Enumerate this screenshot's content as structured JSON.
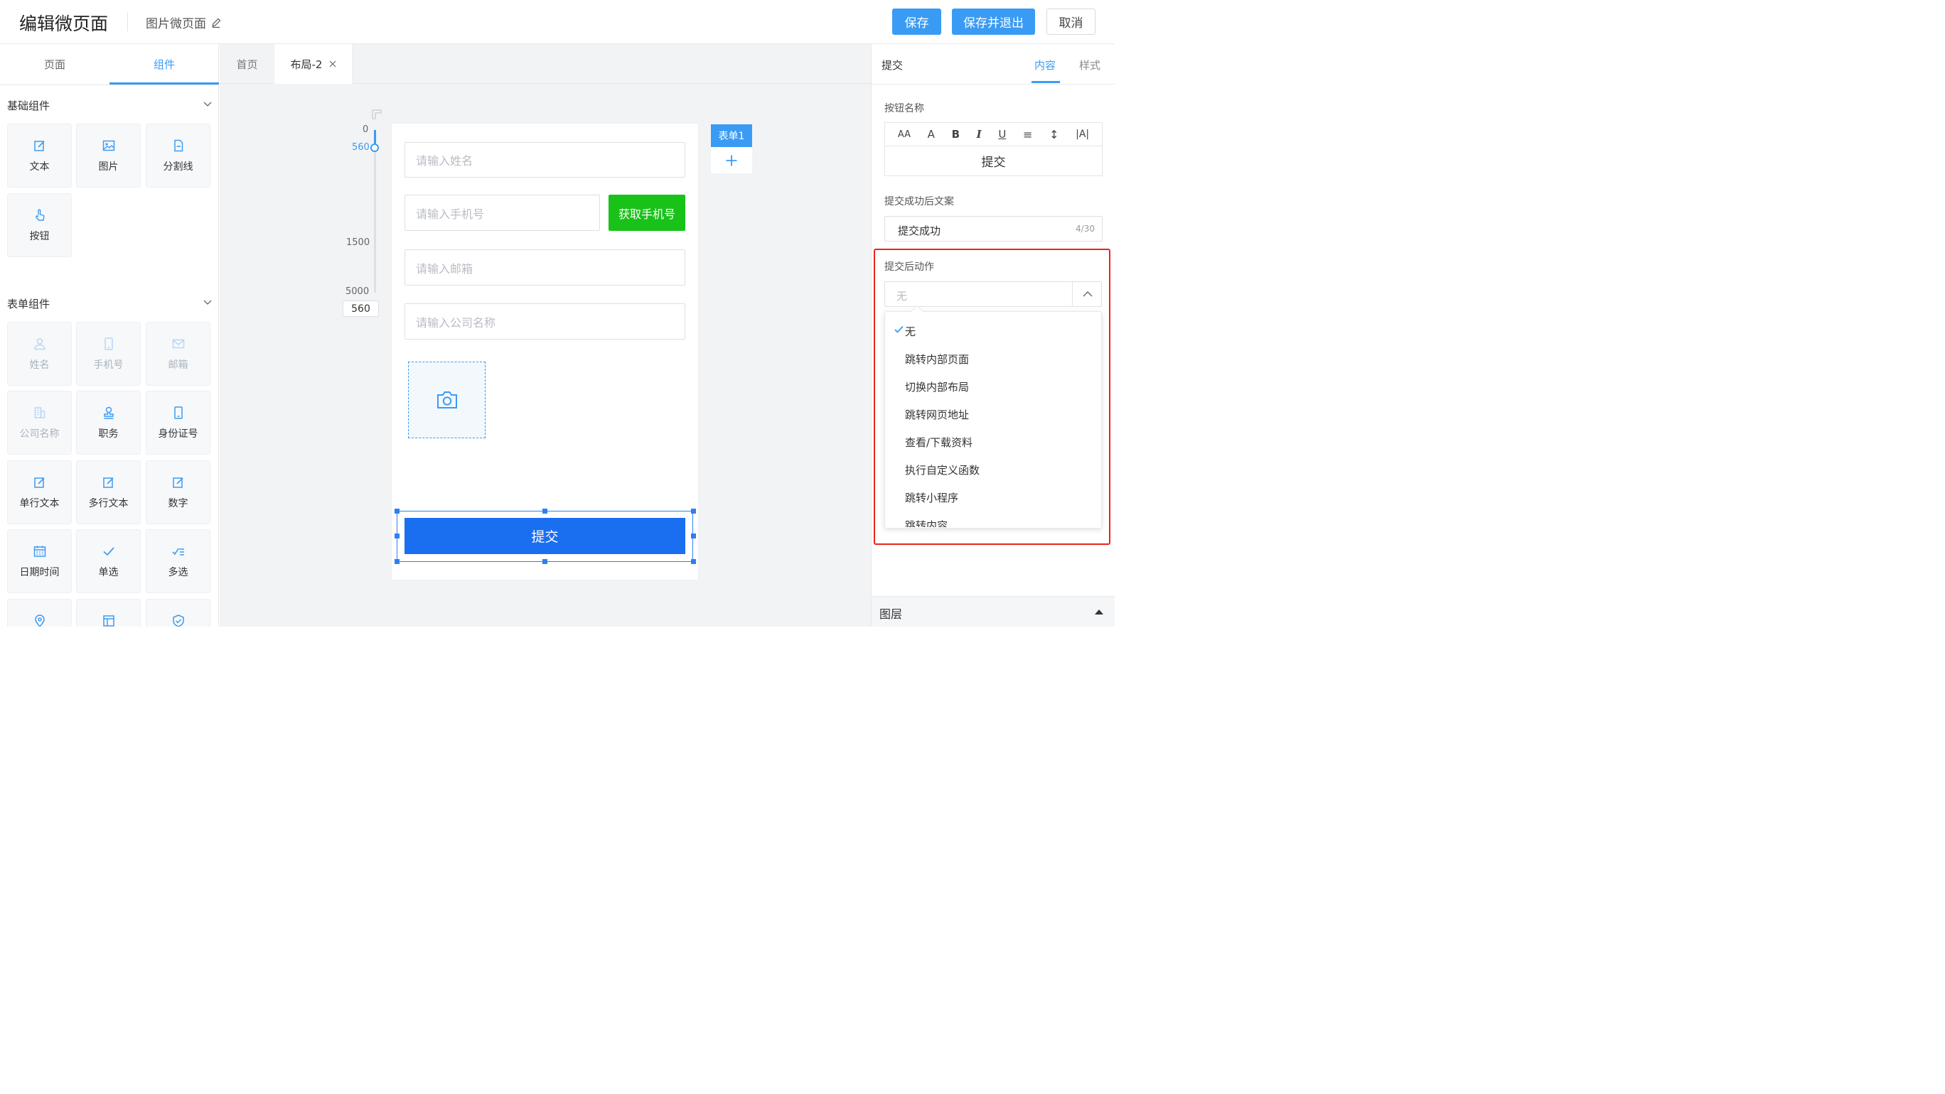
{
  "header": {
    "title": "编辑微页面",
    "page_name": "图片微页面",
    "save": "保存",
    "save_exit": "保存并退出",
    "cancel": "取消"
  },
  "left": {
    "tabs": [
      "页面",
      "组件"
    ],
    "active_tab": "组件",
    "basic": {
      "title": "基础组件",
      "items": [
        "文本",
        "图片",
        "分割线",
        "按钮"
      ]
    },
    "form": {
      "title": "表单组件",
      "items": [
        "姓名",
        "手机号",
        "邮箱",
        "公司名称",
        "职务",
        "身份证号",
        "单行文本",
        "多行文本",
        "数字",
        "日期时间",
        "单选",
        "多选"
      ]
    }
  },
  "canvas": {
    "tabs": [
      "首页",
      "布局-2"
    ],
    "active_tab": "布局-2",
    "ruler": {
      "top": "0",
      "current": "560",
      "mid": "1500",
      "max": "5000",
      "input": "560"
    },
    "form_tag": "表单1",
    "add_symbol": "+",
    "fields": {
      "name": "请输入姓名",
      "phone": "请输入手机号",
      "get_phone": "获取手机号",
      "email": "请输入邮箱",
      "company": "请输入公司名称"
    },
    "submit": "提交"
  },
  "right": {
    "title": "提交",
    "tabs": [
      "内容",
      "样式"
    ],
    "active_tab": "内容",
    "button_name_label": "按钮名称",
    "toolbar": [
      "AA",
      "A",
      "B",
      "I",
      "U",
      "≡",
      "↕",
      "|A|"
    ],
    "button_name_value": "提交",
    "success_label": "提交成功后文案",
    "success_value": "提交成功",
    "success_count": "4/30",
    "action_label": "提交后动作",
    "action_placeholder": "无",
    "options": [
      "无",
      "跳转内部页面",
      "切换内部布局",
      "跳转网页地址",
      "查看/下载资料",
      "执行自定义函数",
      "跳转小程序",
      "跳转内容"
    ],
    "selected_option": "无",
    "layers": "图层"
  },
  "colors": {
    "accent": "#3a9bf4",
    "green": "#19c219",
    "submit_blue": "#1a6ff0",
    "highlight_red": "#e8231e"
  }
}
